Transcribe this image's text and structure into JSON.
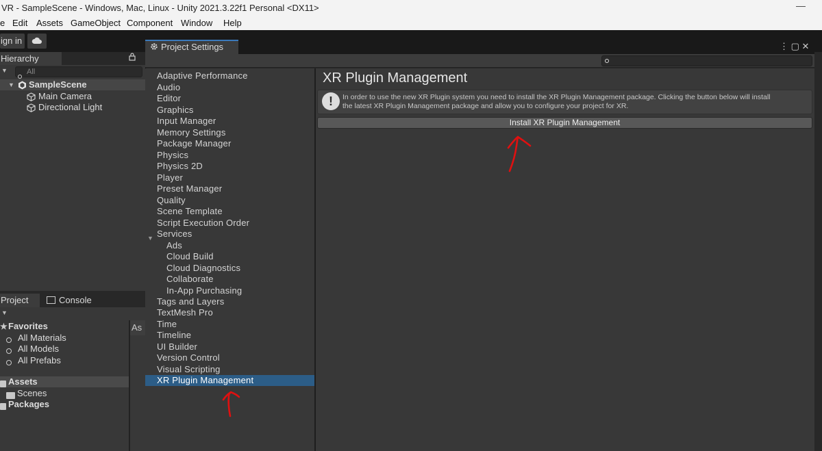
{
  "window": {
    "title": "VR - SampleScene - Windows, Mac, Linux - Unity 2021.3.22f1 Personal <DX11>",
    "minimize_glyph": "—"
  },
  "menu": [
    "Edit",
    "Assets",
    "GameObject",
    "Component",
    "Window",
    "Help"
  ],
  "menu_partial": "e",
  "toolbar": {
    "signin_label": "ign in"
  },
  "hierarchy": {
    "tab_label": "Hierarchy",
    "search_placeholder": "All",
    "scene": "SampleScene",
    "objects": [
      "Main Camera",
      "Directional Light"
    ]
  },
  "project": {
    "tab_label": "Project",
    "console_label": "Console",
    "right_header": "As",
    "favorites_label": "Favorites",
    "favorites": [
      "All Materials",
      "All Models",
      "All Prefabs"
    ],
    "assets_label": "Assets",
    "assets_children": [
      "Scenes"
    ],
    "packages_label": "Packages"
  },
  "project_settings": {
    "tab_label": "Project Settings",
    "nav": [
      "Adaptive Performance",
      "Audio",
      "Editor",
      "Graphics",
      "Input Manager",
      "Memory Settings",
      "Package Manager",
      "Physics",
      "Physics 2D",
      "Player",
      "Preset Manager",
      "Quality",
      "Scene Template",
      "Script Execution Order",
      "Services"
    ],
    "services_children": [
      "Ads",
      "Cloud Build",
      "Cloud Diagnostics",
      "Collaborate",
      "In-App Purchasing"
    ],
    "nav_after": [
      "Tags and Layers",
      "TextMesh Pro",
      "Time",
      "Timeline",
      "UI Builder",
      "Version Control",
      "Visual Scripting",
      "XR Plugin Management"
    ],
    "selected": "XR Plugin Management",
    "content_title": "XR Plugin Management",
    "info_line1": "In order to use the new XR Plugin system you need to install the XR Plugin Management package. Clicking the button below will install",
    "info_line2": "the latest XR Plugin Management package and allow you to configure your project for XR.",
    "install_button": "Install XR Plugin Management",
    "win_btns": "⋮ ▢ ✕"
  },
  "colors": {
    "selection": "#2c5d87",
    "annotation": "#e01010",
    "tab_accent": "#3a79bb"
  }
}
